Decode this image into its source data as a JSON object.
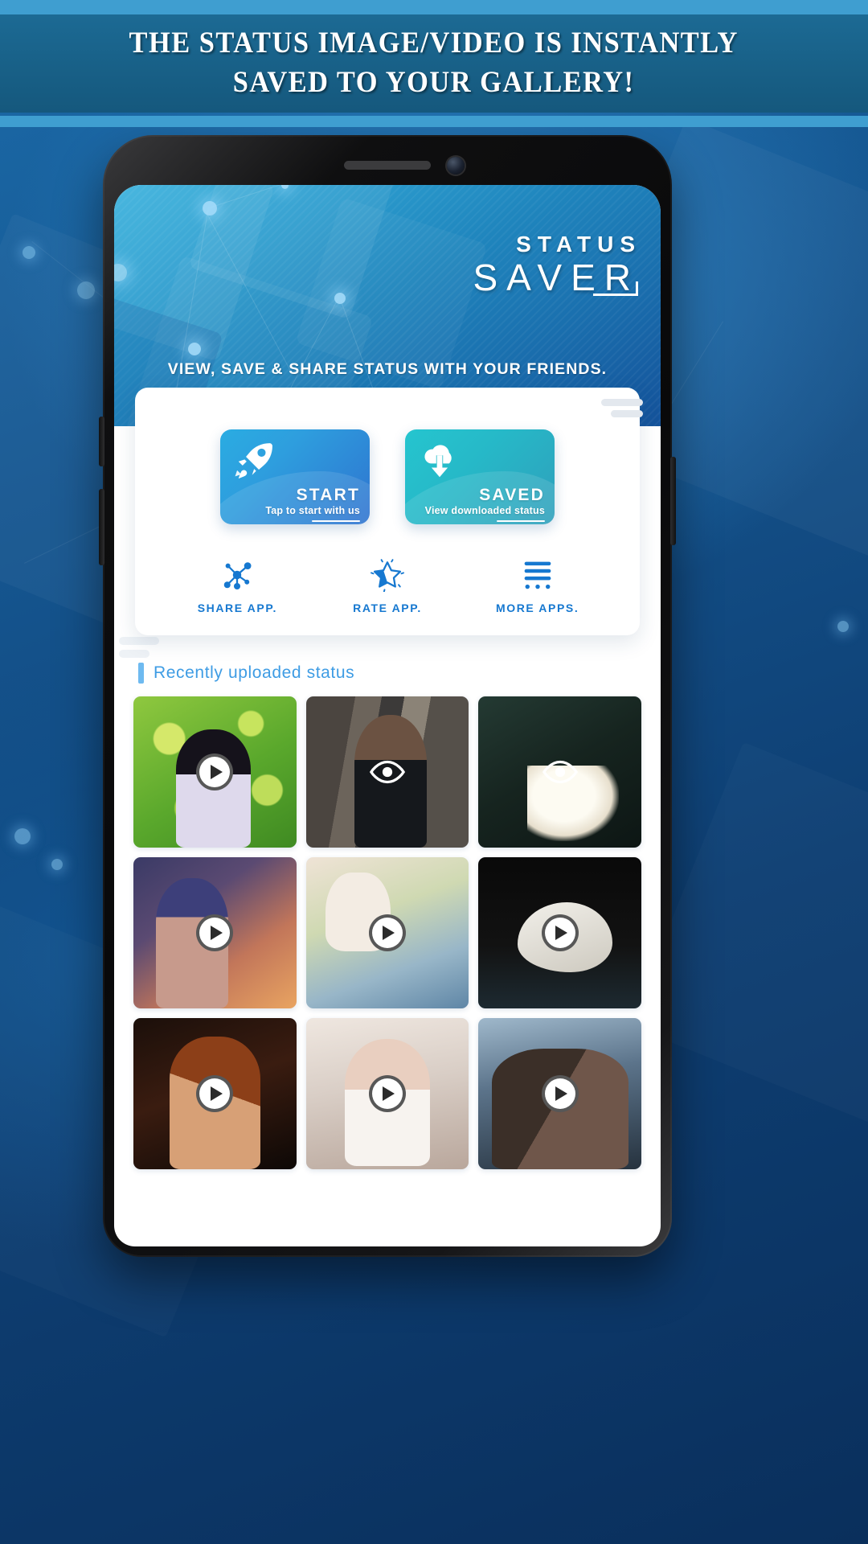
{
  "banner": {
    "line1": "THE STATUS IMAGE/VIDEO IS INSTANTLY",
    "line2": "SAVED TO YOUR GALLERY!"
  },
  "app": {
    "logo_top": "STATUS",
    "logo_main": "SAVER",
    "tagline": "VIEW, SAVE & SHARE STATUS WITH YOUR FRIENDS."
  },
  "cards": [
    {
      "title": "START",
      "subtitle": "Tap to start with us",
      "icon": "rocket-icon",
      "color": "#2e9ede"
    },
    {
      "title": "SAVED",
      "subtitle": "View downloaded status",
      "icon": "cloud-download-icon",
      "color": "#26b9c8"
    }
  ],
  "mini_actions": [
    {
      "label": "SHARE APP.",
      "icon": "share-nodes-icon"
    },
    {
      "label": "RATE APP.",
      "icon": "star-icon"
    },
    {
      "label": "MORE APPS.",
      "icon": "more-apps-icon"
    }
  ],
  "recent": {
    "title": "Recently uploaded status",
    "items": [
      {
        "overlay": "play-icon",
        "alt": "woman-in-green-field"
      },
      {
        "overlay": "eye-icon",
        "alt": "woman-by-tree-trunk"
      },
      {
        "overlay": "eye-icon",
        "alt": "white-flower-closeup"
      },
      {
        "overlay": "play-icon",
        "alt": "woman-with-lantern-art"
      },
      {
        "overlay": "play-icon",
        "alt": "blue-nail-art"
      },
      {
        "overlay": "play-icon",
        "alt": "swan-on-dark-water"
      },
      {
        "overlay": "play-icon",
        "alt": "woman-with-curly-hair"
      },
      {
        "overlay": "play-icon",
        "alt": "baby-in-white-dress"
      },
      {
        "overlay": "play-icon",
        "alt": "couple-taking-selfie"
      }
    ]
  },
  "colors": {
    "banner_bg": "#186087",
    "banner_edge": "#3f9ed0",
    "page_bg": "#14529a",
    "accent_blue": "#1678d0",
    "recent_title": "#3e9ce4",
    "card_start": "#2e9ede",
    "card_saved": "#26b9c8"
  }
}
